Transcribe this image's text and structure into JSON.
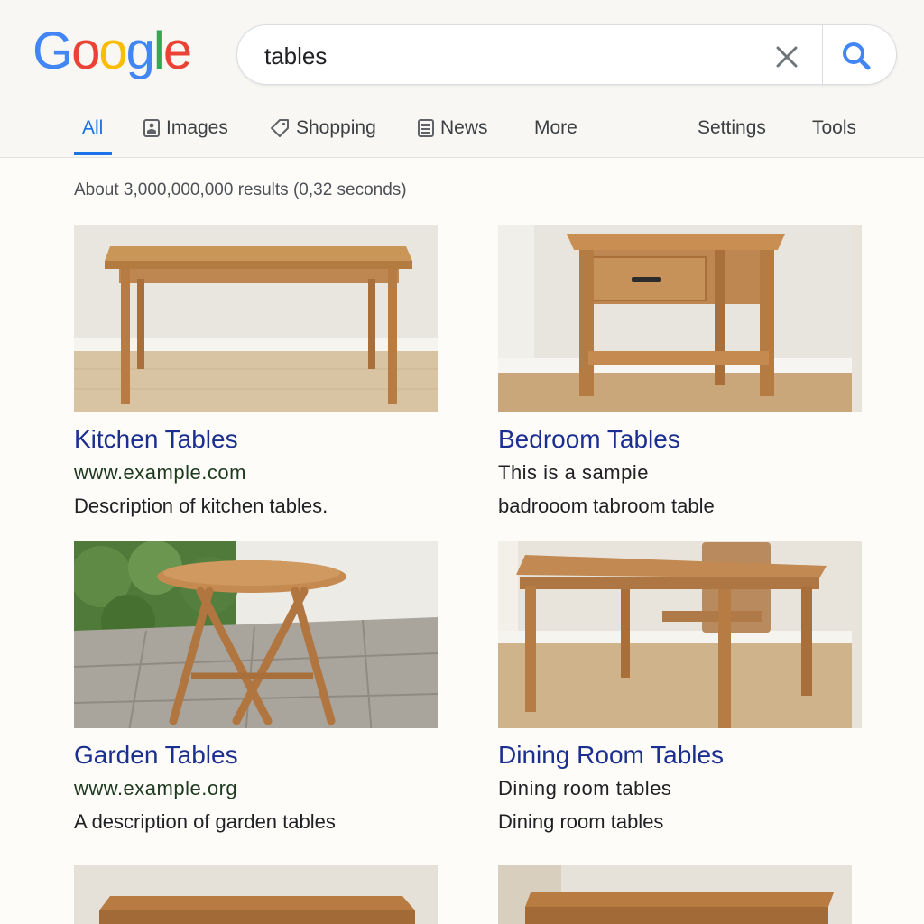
{
  "search": {
    "query": "tables"
  },
  "logo": {
    "letters": [
      "G",
      "o",
      "o",
      "g",
      "l",
      "e"
    ],
    "colors": [
      "#4285F4",
      "#EA4335",
      "#FBBC05",
      "#4285F4",
      "#34A853",
      "#EA4335"
    ]
  },
  "tabs": {
    "all": "All",
    "images": "Images",
    "shopping": "Shopping",
    "news": "News",
    "more": "More",
    "settings": "Settings",
    "tools": "Tools"
  },
  "results": {
    "count_text": "About 3,000,000,000 results (0,32 seconds)",
    "items": [
      {
        "title": "Kitchen Tables",
        "line1": "www.example.com",
        "line2": "Description of kitchen tables."
      },
      {
        "title": "Bedroom Tables",
        "line1": "This is a sampie",
        "line2": "badrooom tabroom table"
      },
      {
        "title": "Garden Tables",
        "line1": "www.example.org",
        "line2": "A description of garden tables"
      },
      {
        "title": "Dining Room Tables",
        "line1": "Dining room tables",
        "line2": "Dining room tables"
      }
    ]
  },
  "colors": {
    "accent": "#1a73e8",
    "link": "#1a2f8f",
    "wood": "#c48a4f"
  },
  "icons": {
    "clear": "close-icon",
    "search": "search-icon",
    "images": "image-icon",
    "shopping": "tag-icon",
    "news": "news-icon"
  }
}
